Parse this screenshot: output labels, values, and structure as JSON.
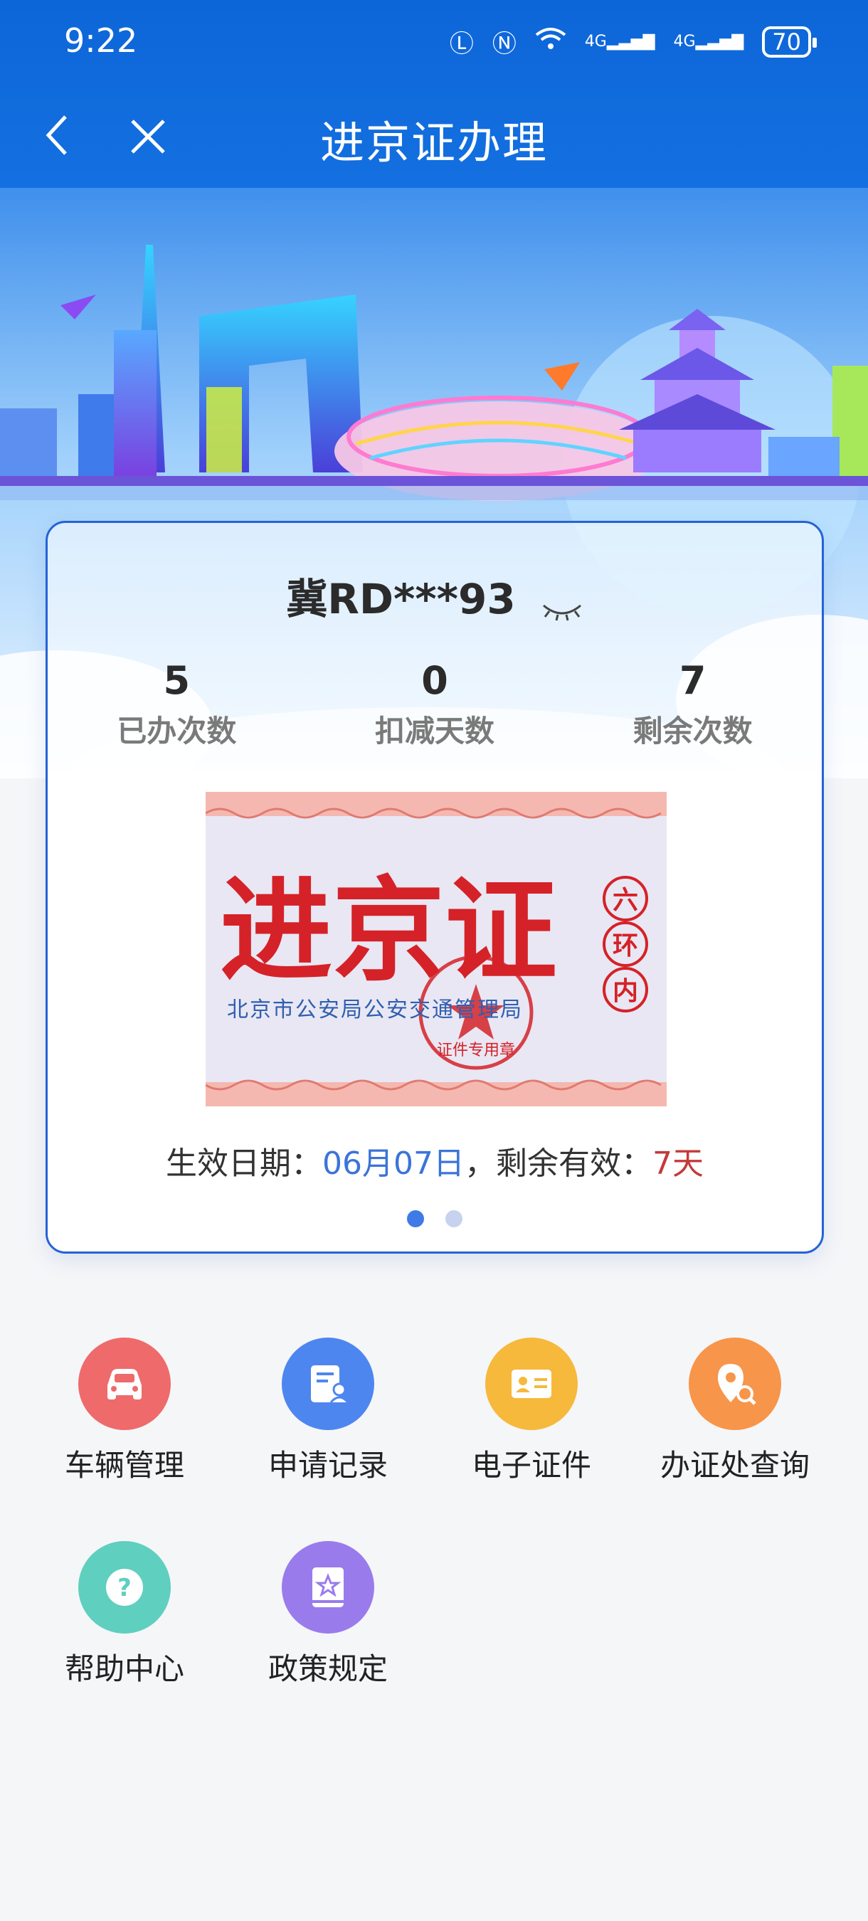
{
  "status_bar": {
    "time": "9:22",
    "network1": "4G",
    "network2": "4G",
    "battery": "70"
  },
  "nav": {
    "title": "进京证办理"
  },
  "card": {
    "plate": "冀RD***93",
    "stats": [
      {
        "value": "5",
        "label": "已办次数"
      },
      {
        "value": "0",
        "label": "扣减天数"
      },
      {
        "value": "7",
        "label": "剩余次数"
      }
    ],
    "permit": {
      "title": "进京证",
      "zone": [
        "六",
        "环",
        "内"
      ],
      "issuer": "北京市公安局公安交通管理局",
      "seal_text": "证件专用章"
    },
    "validity": {
      "prefix": "生效日期：",
      "date": "06月07日",
      "middle": "，剩余有效：",
      "days": "7天"
    },
    "pager": {
      "count": 2,
      "active": 0
    }
  },
  "menu": [
    {
      "label": "车辆管理",
      "icon": "car-icon",
      "color": "#ef6a6a"
    },
    {
      "label": "申请记录",
      "icon": "application-record-icon",
      "color": "#4d86ef"
    },
    {
      "label": "电子证件",
      "icon": "id-card-icon",
      "color": "#f6b93b"
    },
    {
      "label": "办证处查询",
      "icon": "location-search-icon",
      "color": "#f7954a"
    },
    {
      "label": "帮助中心",
      "icon": "help-icon",
      "color": "#5fcfbf"
    },
    {
      "label": "政策规定",
      "icon": "policy-book-icon",
      "color": "#9a7bec"
    }
  ]
}
